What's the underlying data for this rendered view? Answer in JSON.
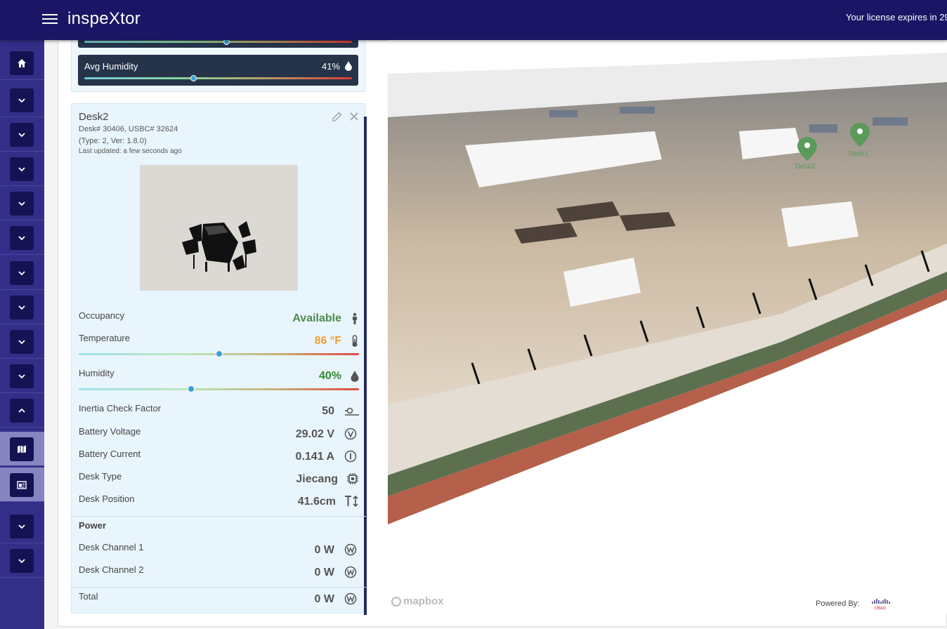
{
  "header": {
    "app_title": "inspeXtor",
    "license_text": "Your license expires in 29"
  },
  "sidebar": {
    "items": [
      {
        "icon": "home-icon",
        "active": false
      },
      {
        "icon": "chevron-down-icon",
        "active": false
      },
      {
        "icon": "chevron-down-icon",
        "active": false
      },
      {
        "icon": "chevron-down-icon",
        "active": false
      },
      {
        "icon": "chevron-down-icon",
        "active": false
      },
      {
        "icon": "chevron-down-icon",
        "active": false
      },
      {
        "icon": "chevron-down-icon",
        "active": false
      },
      {
        "icon": "chevron-down-icon",
        "active": false
      },
      {
        "icon": "chevron-down-icon",
        "active": false
      },
      {
        "icon": "chevron-down-icon",
        "active": false
      },
      {
        "icon": "chevron-up-icon",
        "active": false
      },
      {
        "icon": "map-icon",
        "active": true
      },
      {
        "icon": "image-icon",
        "active": true
      },
      {
        "icon": "chevron-down-icon",
        "active": false
      },
      {
        "icon": "chevron-down-icon",
        "active": false
      }
    ]
  },
  "summary": {
    "avg_humidity_label": "Avg Humidity",
    "avg_humidity_value": "41%",
    "avg_humidity_level": 0.41
  },
  "desk": {
    "title": "Desk2",
    "ids": "Desk# 30406, USBC# 32624",
    "type_ver": "(Type: 2, Ver: 1.8.0)",
    "last_updated": "Last updated: a few seconds ago",
    "occupancy_label": "Occupancy",
    "occupancy_value": "Available",
    "temperature_label": "Temperature",
    "temperature_value": "86 °F",
    "temperature_level": 0.5,
    "humidity_label": "Humidity",
    "humidity_value": "40%",
    "humidity_level": 0.4,
    "inertia_label": "Inertia Check Factor",
    "inertia_value": "50",
    "battery_voltage_label": "Battery Voltage",
    "battery_voltage_value": "29.02 V",
    "battery_current_label": "Battery Current",
    "battery_current_value": "0.141 A",
    "desk_type_label": "Desk Type",
    "desk_type_value": "Jiecang",
    "desk_position_label": "Desk Position",
    "desk_position_value": "41.6cm",
    "power_label": "Power",
    "channel1_label": "Desk Channel 1",
    "channel1_value": "0 W",
    "channel2_label": "Desk Channel 2",
    "channel2_value": "0 W",
    "total_label": "Total",
    "total_value": "0 W"
  },
  "map": {
    "markers": [
      "Desk2",
      "Desk1"
    ],
    "attribution": "mapbox",
    "powered_by": "Powered By:",
    "powered_by_logo": "cisco"
  },
  "colors": {
    "topbar": "#1a1665",
    "sidebar": "#332f88",
    "available": "#4f8a4f",
    "temperature": "#f0a030",
    "humidity": "#2e8b2e",
    "marker": "#5a9a5a"
  }
}
